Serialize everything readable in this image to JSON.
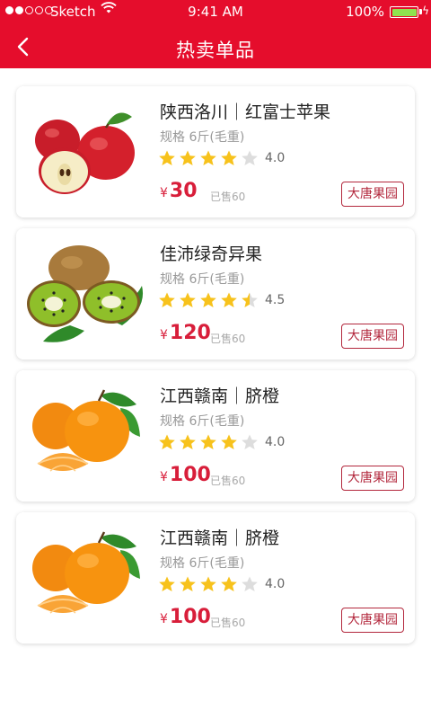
{
  "status_bar": {
    "carrier": "Sketch",
    "time": "9:41 AM",
    "battery": "100%"
  },
  "nav": {
    "title": "热卖单品",
    "back_icon": "chevron-left-icon"
  },
  "colors": {
    "header": "#e50d2c",
    "price": "#d81e3a",
    "store_border": "#b3283d",
    "star_on": "#f7c21c",
    "star_off": "#dddddd"
  },
  "products": [
    {
      "name": "陕西洛川｜红富士苹果",
      "spec": "规格 6斤(毛重)",
      "rating": 4.0,
      "rating_label": "4.0",
      "currency": "¥",
      "price": "30",
      "sold": "已售60",
      "store": "大唐果园",
      "image": "apple"
    },
    {
      "name": "佳沛绿奇异果",
      "spec": "规格 6斤(毛重)",
      "rating": 4.5,
      "rating_label": "4.5",
      "currency": "¥",
      "price": "120",
      "sold": "已售60",
      "store": "大唐果园",
      "image": "kiwi"
    },
    {
      "name": "江西赣南｜脐橙",
      "spec": "规格 6斤(毛重)",
      "rating": 4.0,
      "rating_label": "4.0",
      "currency": "¥",
      "price": "100",
      "sold": "已售60",
      "store": "大唐果园",
      "image": "orange"
    },
    {
      "name": "江西赣南｜脐橙",
      "spec": "规格 6斤(毛重)",
      "rating": 4.0,
      "rating_label": "4.0",
      "currency": "¥",
      "price": "100",
      "sold": "已售60",
      "store": "大唐果园",
      "image": "orange"
    }
  ]
}
